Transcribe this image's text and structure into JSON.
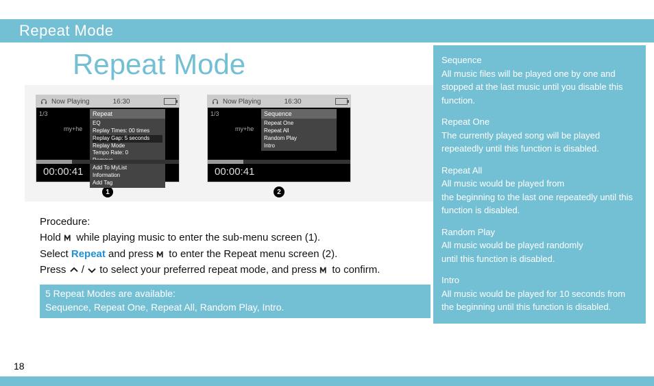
{
  "header": {
    "title": "Repeat Mode"
  },
  "main": {
    "title": "Repeat Mode"
  },
  "page_number": "18",
  "screens": [
    {
      "badge": "1",
      "status": {
        "now_playing": "Now Playing",
        "clock": "16:30"
      },
      "track_no": "1/3",
      "artist": "my+he",
      "elapsed": "00:00:41",
      "menu_title": "Repeat",
      "menu_items": [
        "EQ",
        "Replay Times: 00 times",
        "Replay Gap:     5 seconds",
        "Replay Mode",
        "Tempo Rate:              0",
        "Remove",
        "Add To MyList",
        "Information",
        "Add Tag"
      ]
    },
    {
      "badge": "2",
      "status": {
        "now_playing": "Now Playing",
        "clock": "16:30"
      },
      "track_no": "1/3",
      "artist": "my+he",
      "elapsed": "00:00:41",
      "menu_title": "Sequence",
      "menu_items": [
        "Repeat One",
        "Repeat All",
        "Random Play",
        "Intro"
      ]
    }
  ],
  "procedure": {
    "title": "Procedure:",
    "line1a": "Hold ",
    "line1b": " while playing music to enter the sub-menu screen (1).",
    "line2a": "Select ",
    "line2_hl": "Repeat",
    "line2b": " and press ",
    "line2c": " to enter the Repeat menu screen (2).",
    "line3a": "Press ",
    "line3_sep": " / ",
    "line3b": " to select your preferred repeat mode, and press ",
    "line3c": " to confirm."
  },
  "summary": {
    "line1": "5 Repeat Modes are available:",
    "line2": "Sequence, Repeat One, Repeat All, Random Play, Intro."
  },
  "modes": [
    {
      "title": "Sequence",
      "desc": "All music files will be played one by one and stopped at the last music until you disable this function."
    },
    {
      "title": "Repeat One",
      "desc": "The currently played song will be played repeatedly until this function is disabled."
    },
    {
      "title": "Repeat All",
      "desc": "All music would be played from\nthe beginning to the last one repeatedly until this function is disabled."
    },
    {
      "title": "Random Play",
      "desc": "All music would be played randomly\nuntil this function is disabled."
    },
    {
      "title": "Intro",
      "desc": "All music would be played for 10 seconds from the beginning until this function is disabled."
    }
  ]
}
